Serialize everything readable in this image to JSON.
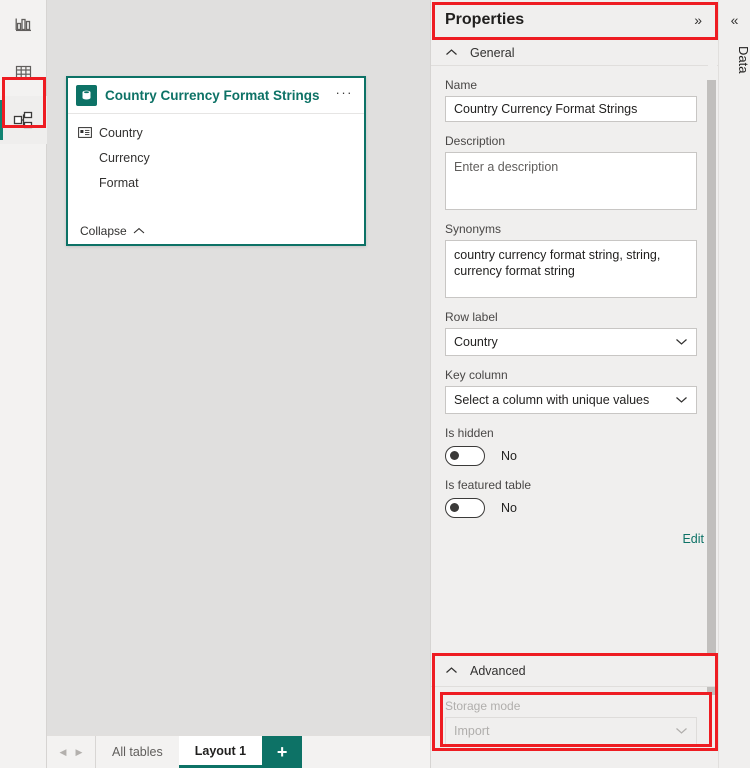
{
  "left_rail": {
    "items": [
      {
        "name": "report-view",
        "icon": "bar-chart-icon",
        "selected": false
      },
      {
        "name": "data-view",
        "icon": "table-grid-icon",
        "selected": false
      },
      {
        "name": "model-view",
        "icon": "model-relationship-icon",
        "selected": true
      }
    ]
  },
  "canvas": {
    "table_card": {
      "title": "Country Currency Format Strings",
      "icon": "table-database-icon",
      "more_menu": "···",
      "fields": [
        {
          "label": "Country",
          "icon": "row-label-card-icon",
          "has_icon": true
        },
        {
          "label": "Currency",
          "icon": "",
          "has_icon": false
        },
        {
          "label": "Format",
          "icon": "",
          "has_icon": false
        }
      ],
      "collapse_label": "Collapse"
    }
  },
  "tabbar": {
    "prev_arrow": "◀",
    "next_arrow": "▶",
    "tabs": [
      {
        "label": "All tables",
        "active": false
      },
      {
        "label": "Layout 1",
        "active": true
      }
    ],
    "add_label": "+"
  },
  "properties": {
    "title": "Properties",
    "expand_icon": "»",
    "sections": {
      "general": {
        "label": "General",
        "chevron": "⌃",
        "name": {
          "label": "Name",
          "value": "Country Currency Format Strings"
        },
        "description": {
          "label": "Description",
          "value": "",
          "placeholder": "Enter a description"
        },
        "synonyms": {
          "label": "Synonyms",
          "value": "country currency format string, string, currency format string"
        },
        "row_label": {
          "label": "Row label",
          "value": "Country"
        },
        "key_column": {
          "label": "Key column",
          "value": "",
          "placeholder": "Select a column with unique values"
        },
        "is_hidden": {
          "label": "Is hidden",
          "value": "No",
          "on": false
        },
        "is_featured_table": {
          "label": "Is featured table",
          "value": "No",
          "on": false
        },
        "edit_link": "Edit"
      },
      "advanced": {
        "label": "Advanced",
        "chevron": "⌃",
        "storage_mode": {
          "label": "Storage mode",
          "value": "Import",
          "disabled": true
        }
      }
    }
  },
  "data_rail": {
    "collapse_icon": "«",
    "label": "Data"
  },
  "colors": {
    "accent_teal": "#0d7266",
    "annotation_red": "#ee1c22",
    "canvas_bg": "#e0dfde",
    "pane_bg": "#f0efee"
  }
}
